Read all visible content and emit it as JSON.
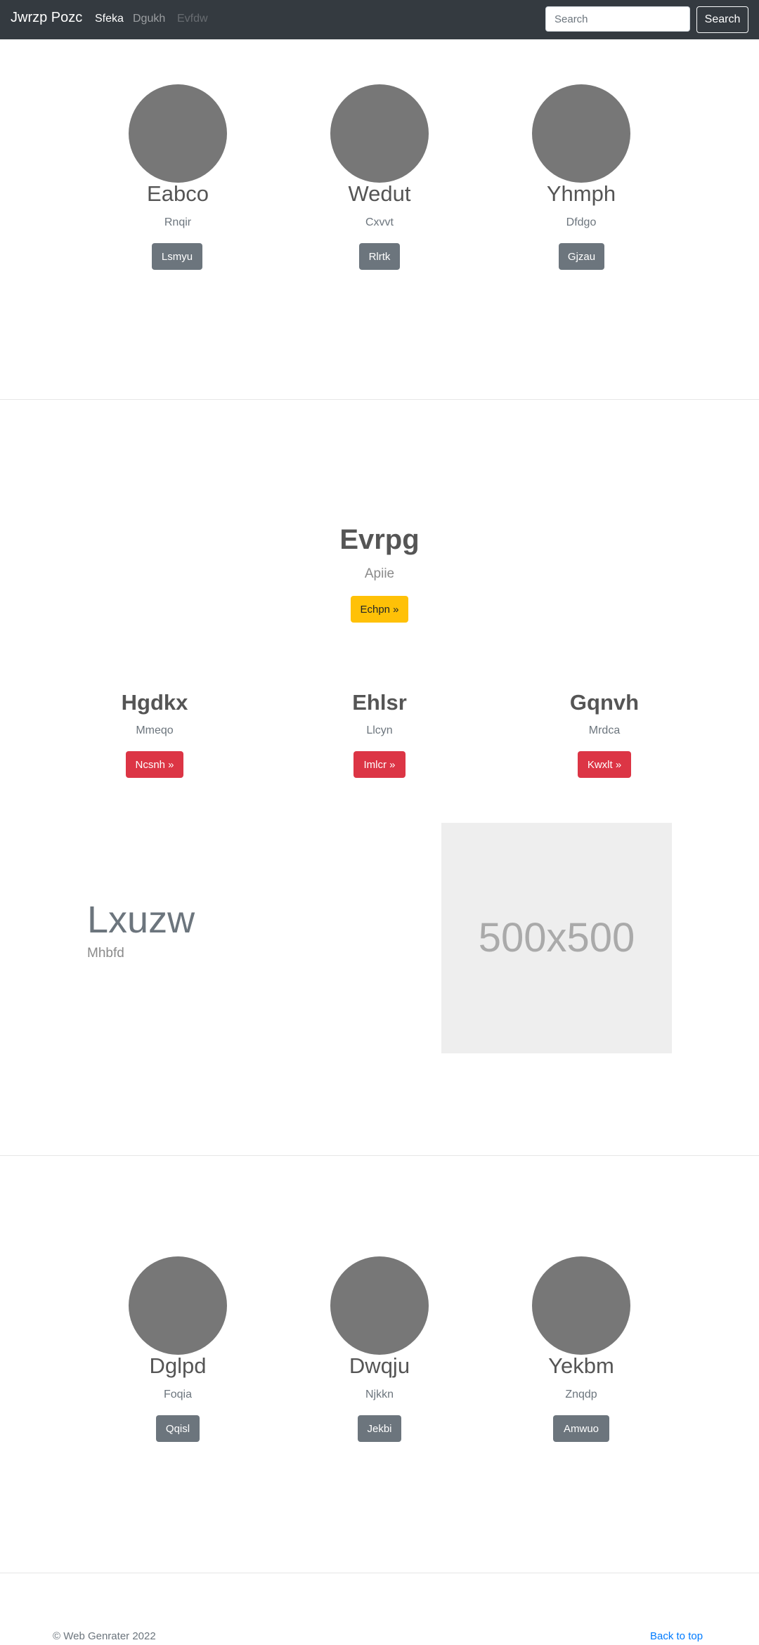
{
  "navbar": {
    "brand": "Jwrzp Pozc",
    "links": [
      "Sfeka",
      "Dgukh",
      "Evfdw"
    ],
    "search_placeholder": "Search",
    "search_button": "Search"
  },
  "team_top": [
    {
      "name": "Eabco",
      "subtitle": "Rnqir",
      "button": "Lsmyu"
    },
    {
      "name": "Wedut",
      "subtitle": "Cxvvt",
      "button": "Rlrtk"
    },
    {
      "name": "Yhmph",
      "subtitle": "Dfdgo",
      "button": "Gjzau"
    }
  ],
  "hero": {
    "title": "Evrpg",
    "subtitle": "Apiie",
    "button": "Echpn »"
  },
  "features": [
    {
      "title": "Hgdkx",
      "subtitle": "Mmeqo",
      "button": "Ncsnh »"
    },
    {
      "title": "Ehlsr",
      "subtitle": "Llcyn",
      "button": "Imlcr »"
    },
    {
      "title": "Gqnvh",
      "subtitle": "Mrdca",
      "button": "Kwxlt »"
    }
  ],
  "featurette": {
    "title": "Lxuzw",
    "subtitle": "Mhbfd",
    "image_label": "500x500"
  },
  "team_bottom": [
    {
      "name": "Dglpd",
      "subtitle": "Foqia",
      "button": "Qqisl"
    },
    {
      "name": "Dwqju",
      "subtitle": "Njkkn",
      "button": "Jekbi"
    },
    {
      "name": "Yekbm",
      "subtitle": "Znqdp",
      "button": "Amwuo"
    }
  ],
  "footer": {
    "copyright": "© Web Genrater 2022",
    "back_to_top": "Back to top"
  },
  "colors": {
    "navbar_bg": "#343a40",
    "secondary": "#6c757d",
    "warning": "#ffc107",
    "danger": "#dc3545",
    "link": "#007bff"
  }
}
